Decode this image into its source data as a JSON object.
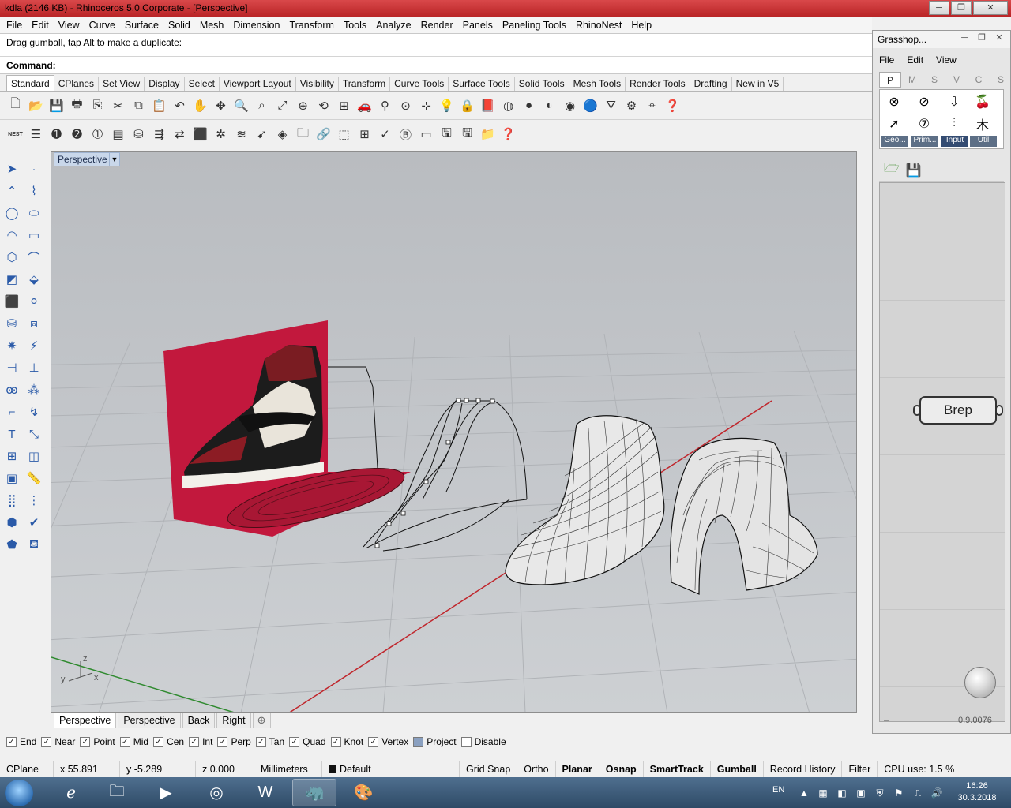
{
  "window": {
    "title": "kdla (2146 KB) - Rhinoceros  5.0 Corporate - [Perspective]",
    "minimize": "─",
    "maximize": "❐",
    "close": "✕"
  },
  "menu": [
    "File",
    "Edit",
    "View",
    "Curve",
    "Surface",
    "Solid",
    "Mesh",
    "Dimension",
    "Transform",
    "Tools",
    "Analyze",
    "Render",
    "Panels",
    "Paneling Tools",
    "RhinoNest",
    "Help"
  ],
  "command": {
    "history": "Drag gumball, tap Alt to make a duplicate:",
    "prompt": "Command:"
  },
  "toolbar_tabs": [
    "Standard",
    "CPlanes",
    "Set View",
    "Display",
    "Select",
    "Viewport Layout",
    "Visibility",
    "Transform",
    "Curve Tools",
    "Surface Tools",
    "Solid Tools",
    "Mesh Tools",
    "Render Tools",
    "Drafting",
    "New in V5"
  ],
  "toolbar_tab_active": "Standard",
  "viewport": {
    "label": "Perspective",
    "axis_x": "x",
    "axis_y": "y",
    "axis_z": "z"
  },
  "viewport_tabs": [
    "Perspective",
    "Perspective",
    "Back",
    "Right"
  ],
  "viewport_tab_add": "⊕",
  "osnaps": [
    {
      "label": "End",
      "checked": true
    },
    {
      "label": "Near",
      "checked": true
    },
    {
      "label": "Point",
      "checked": true
    },
    {
      "label": "Mid",
      "checked": true
    },
    {
      "label": "Cen",
      "checked": true
    },
    {
      "label": "Int",
      "checked": true
    },
    {
      "label": "Perp",
      "checked": true
    },
    {
      "label": "Tan",
      "checked": true
    },
    {
      "label": "Quad",
      "checked": true
    },
    {
      "label": "Knot",
      "checked": true
    },
    {
      "label": "Vertex",
      "checked": true
    },
    {
      "label": "Project",
      "checked": false
    },
    {
      "label": "Disable",
      "checked": false
    }
  ],
  "status": {
    "cplane": "CPlane",
    "x": "x 55.891",
    "y": "y -5.289",
    "z": "z 0.000",
    "units": "Millimeters",
    "layer": "Default",
    "grid_snap": "Grid Snap",
    "ortho": "Ortho",
    "planar": "Planar",
    "osnap": "Osnap",
    "smarttrack": "SmartTrack",
    "gumball": "Gumball",
    "record_history": "Record History",
    "filter": "Filter",
    "cpu": "CPU use: 1.5 %"
  },
  "grasshopper": {
    "title": "Grasshop...",
    "menu": [
      "File",
      "Edit",
      "View"
    ],
    "tabs": [
      "P",
      "M",
      "S",
      "V",
      "C",
      "S"
    ],
    "categories": [
      "Geo...",
      "Prim...",
      "Input",
      "Util"
    ],
    "component": "Brep",
    "version": "0.9.0076",
    "min_label": "–"
  },
  "taskbar": {
    "lang": "EN",
    "time": "16:26",
    "date": "30.3.2018"
  },
  "colors": {
    "titlebar": "#c9292b",
    "red_backdrop": "#c2183d",
    "x_axis": "#c0262c",
    "y_axis": "#2f8a2f"
  }
}
